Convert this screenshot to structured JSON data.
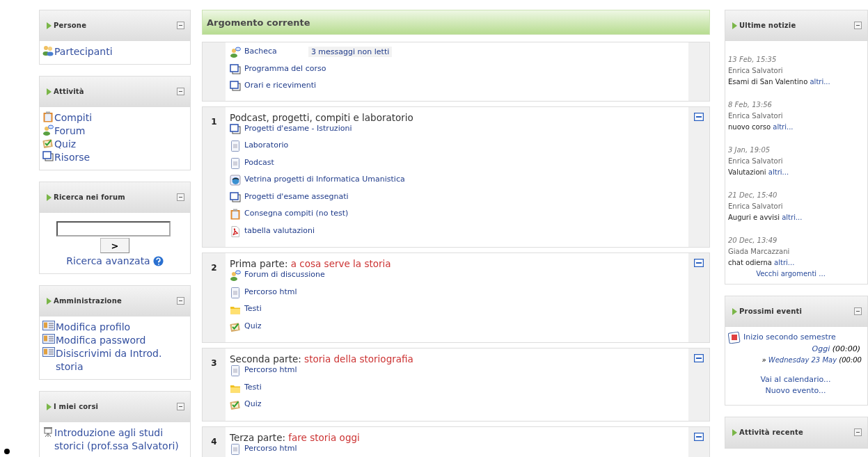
{
  "left_blocks": [
    {
      "kind": "links",
      "title": "Persone",
      "items": [
        {
          "kind": "people",
          "label": "Partecipanti"
        }
      ]
    },
    {
      "kind": "links",
      "title": "Attività",
      "items": [
        {
          "kind": "assignment",
          "label": "Compiti"
        },
        {
          "kind": "forum",
          "label": "Forum"
        },
        {
          "kind": "quiz",
          "label": "Quiz"
        },
        {
          "kind": "resource",
          "label": "Risorse"
        }
      ]
    },
    {
      "kind": "search",
      "title": "Ricerca nei forum",
      "button": ">",
      "link": "Ricerca avanzata"
    },
    {
      "kind": "links",
      "title": "Amministrazione",
      "items": [
        {
          "kind": "profile",
          "label": "Modifica profilo"
        },
        {
          "kind": "profile",
          "label": "Modifica password"
        },
        {
          "kind": "profile",
          "label": "Disiscrivimi da Introd. storia"
        }
      ]
    },
    {
      "kind": "links",
      "title": "I miei corsi",
      "items": [
        {
          "kind": "course",
          "label": "Introduzione agli studi storici (prof.ssa Salvatori)"
        }
      ]
    }
  ],
  "center": {
    "title": "Argomento corrente",
    "sections": [
      {
        "items": [
          {
            "kind": "forum",
            "label": "Bacheca",
            "badge": "3 messaggi non letti"
          },
          {
            "kind": "resource",
            "label": "Programma del corso"
          },
          {
            "kind": "resource",
            "label": "Orari e ricevimenti"
          }
        ]
      },
      {
        "number": "1",
        "title": "Podcast, progetti, compiti e laboratorio",
        "items": [
          {
            "kind": "resource",
            "label": "Progetti d'esame - Istruzioni"
          },
          {
            "kind": "page",
            "label": "Laboratorio"
          },
          {
            "kind": "page",
            "label": "Podcast"
          },
          {
            "kind": "web",
            "label": "Vetrina progetti di Informatica Umanistica"
          },
          {
            "kind": "resource",
            "label": "Progetti d'esame assegnati"
          },
          {
            "kind": "assignment",
            "label": "Consegna compiti (no test)"
          },
          {
            "kind": "pdf",
            "label": "tabella valutazioni"
          }
        ]
      },
      {
        "number": "2",
        "title": "Prima parte:",
        "subtitle": "a cosa serve la storia",
        "items": [
          {
            "kind": "forum",
            "label": "Forum di discussione"
          },
          {
            "kind": "page",
            "label": "Percorso html"
          },
          {
            "kind": "folder",
            "label": "Testi"
          },
          {
            "kind": "quiz",
            "label": "Quiz"
          }
        ]
      },
      {
        "number": "3",
        "title": "Seconda parte:",
        "subtitle": "storia della storiografia",
        "items": [
          {
            "kind": "page",
            "label": "Percorso html"
          },
          {
            "kind": "folder",
            "label": "Testi"
          },
          {
            "kind": "quiz",
            "label": "Quiz"
          }
        ]
      },
      {
        "number": "4",
        "title": "Terza parte:",
        "subtitle": "fare storia oggi",
        "items": [
          {
            "kind": "page",
            "label": "Percorso html"
          }
        ]
      }
    ]
  },
  "news": {
    "title": "Ultime notizie",
    "items": [
      {
        "date": "13 Feb, 15:35",
        "author": "Enrica Salvatori",
        "text": "Esami di San Valentino",
        "link": "altri..."
      },
      {
        "date": "8 Feb, 13:56",
        "author": "Enrica Salvatori",
        "text": "nuovo corso",
        "link": "altri..."
      },
      {
        "date": "3 Jan, 19:05",
        "author": "Enrica Salvatori",
        "text": "Valutazioni",
        "link": "altri..."
      },
      {
        "date": "21 Dec, 15:40",
        "author": "Enrica Salvatori",
        "text": "Auguri e avvisi",
        "link": "altri..."
      },
      {
        "date": "20 Dec, 13:49",
        "author": "Giada Marcazzani",
        "text": "chat odierna",
        "link": "altri..."
      }
    ],
    "footer": "Vecchi argomenti ..."
  },
  "events": {
    "title": "Prossimi eventi",
    "event": {
      "label": "Inizio secondo semestre",
      "day": "Oggi",
      "time": "(00:00)",
      "marker": "»",
      "end_day": "Wednesday 23 May",
      "end_time": "(00:00"
    },
    "links": [
      "Vai al calendario...",
      "Nuovo evento..."
    ]
  },
  "recent": {
    "title": "Attività recente"
  }
}
